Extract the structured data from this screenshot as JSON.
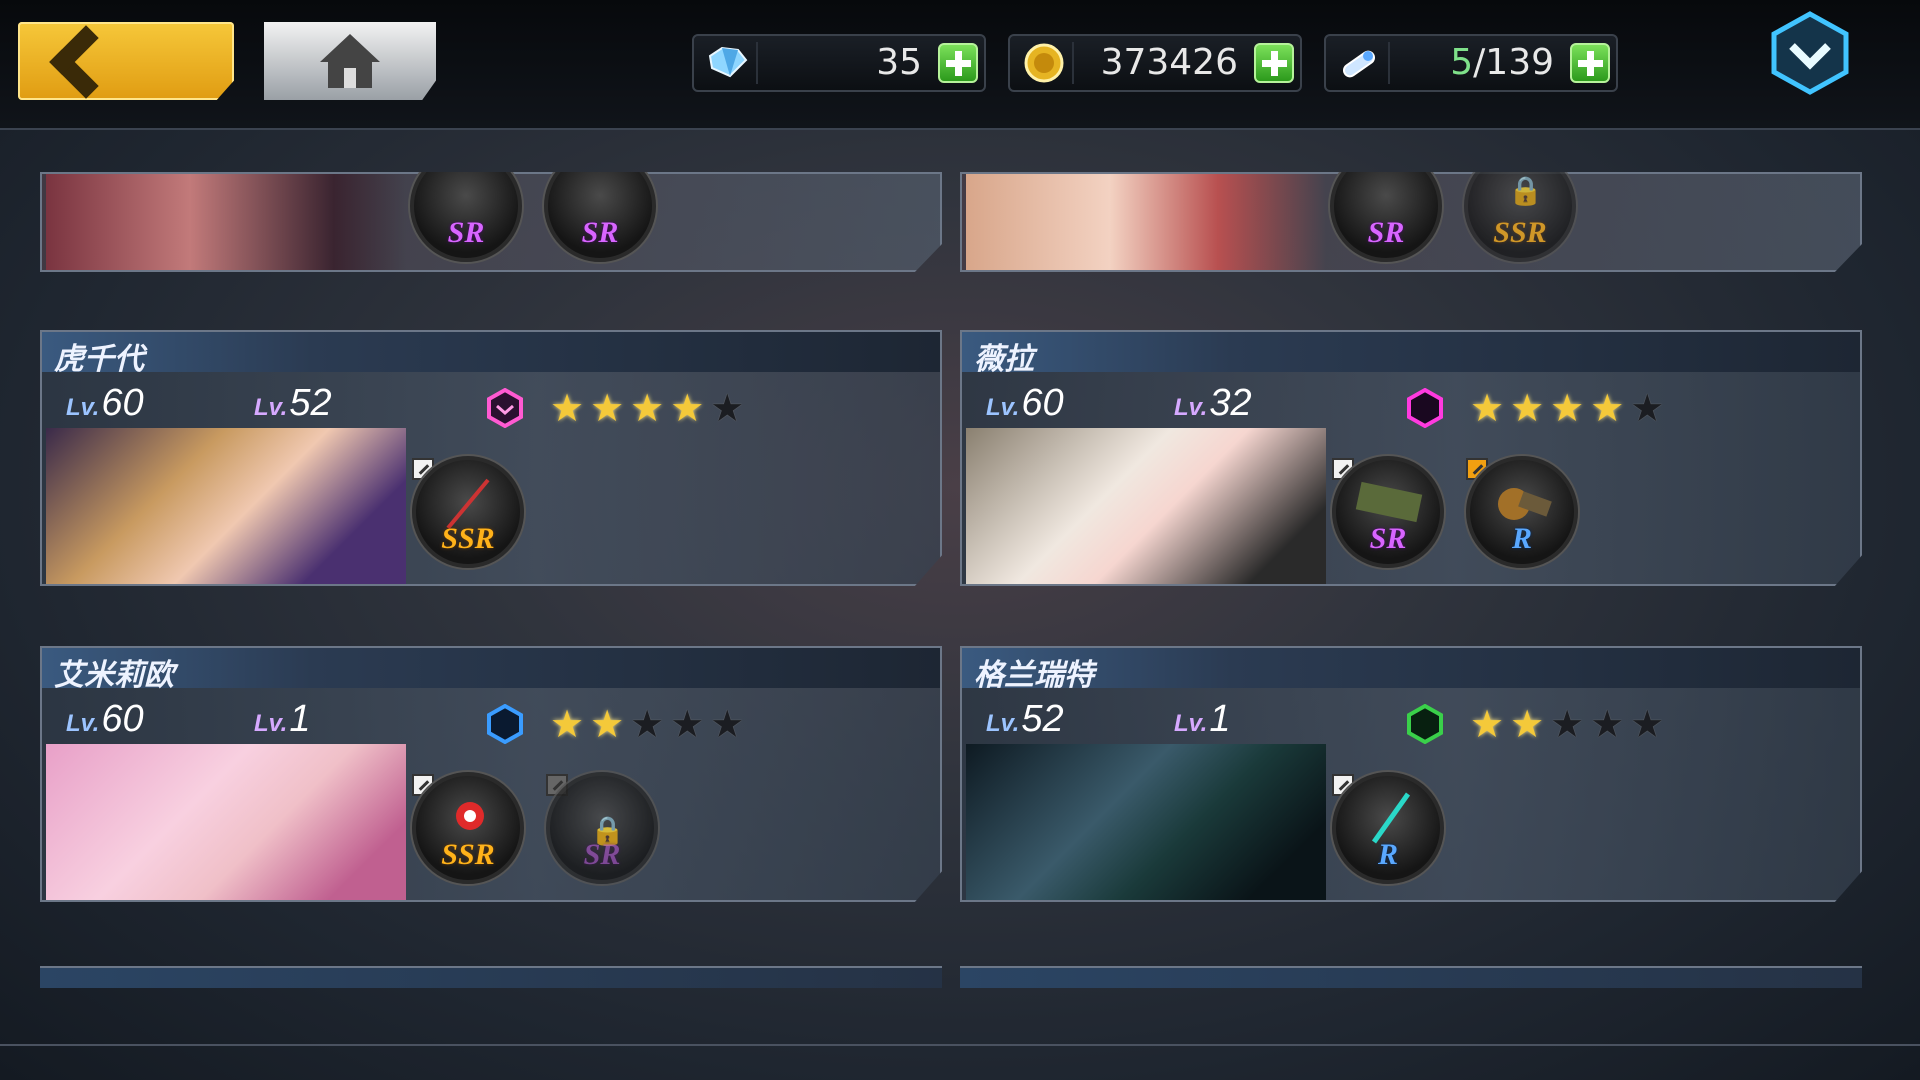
{
  "header": {
    "back_label": "",
    "home_label": "",
    "gems": "35",
    "gold": "373426",
    "stamina_current": "5",
    "stamina_max": "/139"
  },
  "colors": {
    "accent_gold": "#f6c83a",
    "plus_green": "#4cc02e",
    "ssr": "#ffb21a",
    "sr": "#d865ff",
    "r": "#5aa8ff"
  },
  "top_partial_cards": [
    {
      "equips": [
        {
          "rarity": "SR",
          "icon": "fan-icon"
        },
        {
          "rarity": "SR",
          "icon": "whip-icon"
        }
      ]
    },
    {
      "equips": [
        {
          "rarity": "SR",
          "icon": "gauntlet-icon"
        },
        {
          "rarity": "SSR",
          "icon": "lock-icon",
          "locked": true
        }
      ]
    }
  ],
  "cards": [
    {
      "name": "虎千代",
      "level": "60",
      "weapon_level": "52",
      "element": "pink",
      "stars": 4,
      "max_stars": 5,
      "equips": [
        {
          "rarity": "SSR",
          "icon": "spear-icon"
        }
      ]
    },
    {
      "name": "薇拉",
      "level": "60",
      "weapon_level": "32",
      "element": "magenta",
      "stars": 4,
      "max_stars": 5,
      "equips": [
        {
          "rarity": "SR",
          "icon": "death-box-icon"
        },
        {
          "rarity": "R",
          "icon": "cannon-icon"
        }
      ]
    },
    {
      "name": "艾米莉欧",
      "level": "60",
      "weapon_level": "1",
      "element": "blue",
      "stars": 2,
      "max_stars": 5,
      "equips": [
        {
          "rarity": "SSR",
          "icon": "flower-icon"
        },
        {
          "rarity": "SR",
          "icon": "lock-icon",
          "locked": true
        }
      ]
    },
    {
      "name": "格兰瑞特",
      "level": "52",
      "weapon_level": "1",
      "element": "green",
      "stars": 2,
      "max_stars": 5,
      "equips": [
        {
          "rarity": "R",
          "icon": "sword-icon"
        }
      ]
    }
  ],
  "level_prefix": "Lv."
}
